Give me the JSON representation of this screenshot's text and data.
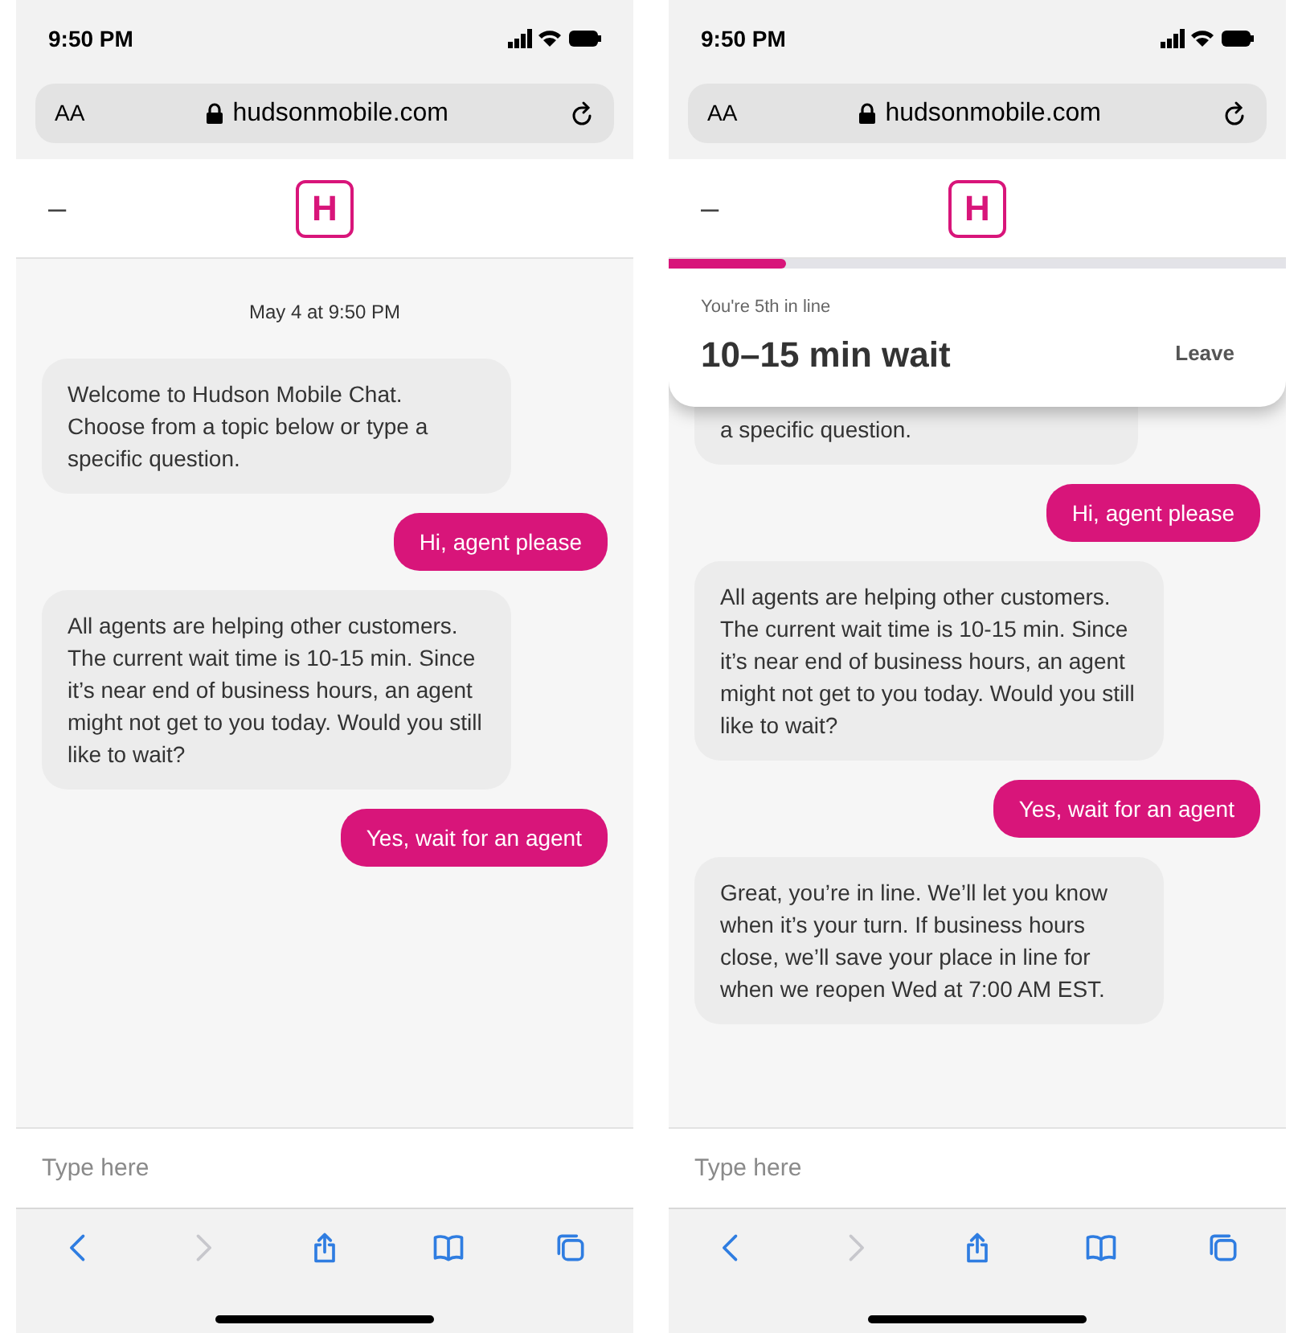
{
  "phones": [
    {
      "status_bar": {
        "time": "9:50 PM"
      },
      "url_bar": {
        "text_size": "AA",
        "address": "hudsonmobile.com"
      },
      "header": {
        "minimize": "–",
        "logo": "H"
      },
      "chat": {
        "timestamp": "May 4 at 9:50 PM",
        "messages": [
          {
            "kind": "received",
            "text": "Welcome to Hudson Mobile Chat. Choose from a topic below or type a specific question.",
            "partial": false
          },
          {
            "kind": "sent",
            "text": "Hi, agent please"
          },
          {
            "kind": "received",
            "text": "All agents are helping other customers. The current wait time is 10-15 min. Since it’s near end of business hours, an agent might not get to you today. Would you still like to wait?",
            "partial": false
          },
          {
            "kind": "sent",
            "text": "Yes, wait for an agent"
          }
        ]
      },
      "input": {
        "placeholder": "Type here"
      },
      "toolbar": [
        {
          "kind": "back",
          "disabled": false
        },
        {
          "kind": "forward",
          "disabled": true
        },
        {
          "kind": "share",
          "disabled": false
        },
        {
          "kind": "bookmarks",
          "disabled": false
        },
        {
          "kind": "tabs",
          "disabled": false
        }
      ]
    },
    {
      "status_bar": {
        "time": "9:50 PM"
      },
      "url_bar": {
        "text_size": "AA",
        "address": "hudsonmobile.com"
      },
      "header": {
        "minimize": "–",
        "logo": "H"
      },
      "queue": {
        "level": 0.19,
        "position": "You're 5th in line",
        "wait": "10–15 min wait",
        "leave": "Leave"
      },
      "chat": {
        "messages": [
          {
            "kind": "received",
            "text": "a specific question.",
            "partial": true
          },
          {
            "kind": "sent",
            "text": "Hi, agent please"
          },
          {
            "kind": "received",
            "text": "All agents are helping other customers. The current wait time is 10-15 min. Since it’s near end of business hours, an agent might not get to you today. Would you still like to wait?",
            "partial": false
          },
          {
            "kind": "sent",
            "text": "Yes, wait for an agent"
          },
          {
            "kind": "received",
            "text": "Great, you’re in line. We’ll let you know when it’s your turn. If business hours close, we’ll save your place in line for when we reopen Wed at 7:00 AM EST.",
            "partial": false
          }
        ]
      },
      "input": {
        "placeholder": "Type here"
      },
      "toolbar": [
        {
          "kind": "back",
          "disabled": false
        },
        {
          "kind": "forward",
          "disabled": true
        },
        {
          "kind": "share",
          "disabled": false
        },
        {
          "kind": "bookmarks",
          "disabled": false
        },
        {
          "kind": "tabs",
          "disabled": false
        }
      ]
    }
  ]
}
